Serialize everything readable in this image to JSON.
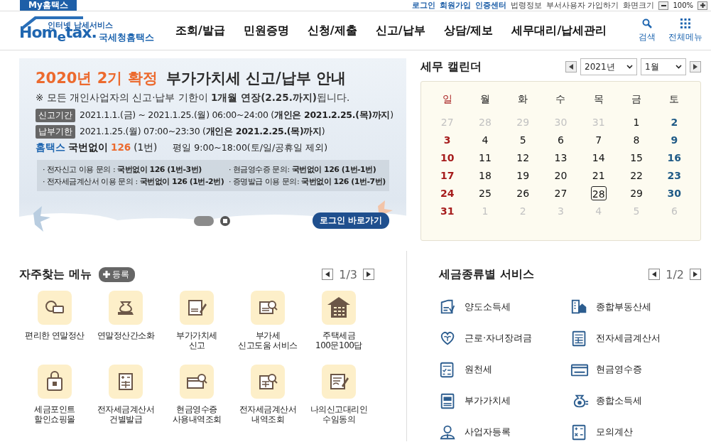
{
  "top_bar": {
    "tab": "My홈택스",
    "links": [
      "로그인",
      "회원가입",
      "인증센터"
    ],
    "sub_links": [
      "법령정보",
      "부서사용자 가입하기"
    ],
    "zoom_label": "화면크기",
    "zoom_value": "100%"
  },
  "header": {
    "logo_small": "인터넷 납세서비스",
    "logo": "Hom$_{e}$tax.",
    "logo_org": "국세청홈택스",
    "nav": [
      "조회/발급",
      "민원증명",
      "신청/제출",
      "신고/납부",
      "상담/제보",
      "세무대리/납세관리"
    ],
    "search": "검색",
    "all_menu": "전체메뉴"
  },
  "banner": {
    "title_highlight": "2020년 2기 확정",
    "title": "부가가치세 신고/납부 안내",
    "notice": "※ 모든 개인사업자의 신고·납부 기한이 **1개월 연장(2.25.까지)**됩니다.",
    "periods": [
      {
        "label": "신고기간",
        "text": "2021.1.1.(금) ~ 2021.1.25.(월) 06:00~24:00 (**개인은 2021.2.25.(목)까지**)"
      },
      {
        "label": "납부기한",
        "text": "2021.1.25.(월) 07:00~23:30 (**개인은 2021.2.25.(목)까지**)"
      }
    ],
    "phone": {
      "brand": "홈택스",
      "prefix": "국번없이",
      "number": "126",
      "suffix": "(1번)",
      "hours": "평일 9:00~18:00(토/일/공휴일 제외)"
    },
    "inquiries": [
      "· 전자신고 이용 문의 : **국번없이 126 (1번-3번)**",
      "· 현금영수증 문의: **국번없이 126 (1번-1번)**",
      "· 전자세금계산서 이용 문의 : **국번없이 126 (1번-2번)**",
      "· 증명발급 이용 문의: **국번없이 126 (1번-7번)**"
    ],
    "login_button": "로그인 바로가기"
  },
  "calendar": {
    "title": "세무 캘린더",
    "year": "2021년",
    "month": "1월",
    "weekdays": [
      "일",
      "월",
      "화",
      "수",
      "목",
      "금",
      "토"
    ],
    "weeks": [
      [
        {
          "day": "27",
          "muted": true,
          "selected": false
        },
        {
          "day": "28",
          "muted": true,
          "selected": false
        },
        {
          "day": "29",
          "muted": true,
          "selected": false
        },
        {
          "day": "30",
          "muted": true,
          "selected": false
        },
        {
          "day": "31",
          "muted": true,
          "selected": false
        },
        {
          "day": "1",
          "muted": false,
          "selected": false
        },
        {
          "day": "2",
          "muted": false,
          "selected": false
        }
      ],
      [
        {
          "day": "3",
          "muted": false,
          "selected": false
        },
        {
          "day": "4",
          "muted": false,
          "selected": false
        },
        {
          "day": "5",
          "muted": false,
          "selected": false
        },
        {
          "day": "6",
          "muted": false,
          "selected": false
        },
        {
          "day": "7",
          "muted": false,
          "selected": false
        },
        {
          "day": "8",
          "muted": false,
          "selected": false
        },
        {
          "day": "9",
          "muted": false,
          "selected": false
        }
      ],
      [
        {
          "day": "10",
          "muted": false,
          "selected": false
        },
        {
          "day": "11",
          "muted": false,
          "selected": false
        },
        {
          "day": "12",
          "muted": false,
          "selected": false
        },
        {
          "day": "13",
          "muted": false,
          "selected": false
        },
        {
          "day": "14",
          "muted": false,
          "selected": false
        },
        {
          "day": "15",
          "muted": false,
          "selected": false
        },
        {
          "day": "16",
          "muted": false,
          "selected": false
        }
      ],
      [
        {
          "day": "17",
          "muted": false,
          "selected": false
        },
        {
          "day": "18",
          "muted": false,
          "selected": false
        },
        {
          "day": "19",
          "muted": false,
          "selected": false
        },
        {
          "day": "20",
          "muted": false,
          "selected": false
        },
        {
          "day": "21",
          "muted": false,
          "selected": false
        },
        {
          "day": "22",
          "muted": false,
          "selected": false
        },
        {
          "day": "23",
          "muted": false,
          "selected": false
        }
      ],
      [
        {
          "day": "24",
          "muted": false,
          "selected": false
        },
        {
          "day": "25",
          "muted": false,
          "selected": false
        },
        {
          "day": "26",
          "muted": false,
          "selected": false
        },
        {
          "day": "27",
          "muted": false,
          "selected": false
        },
        {
          "day": "28",
          "muted": false,
          "selected": true
        },
        {
          "day": "29",
          "muted": false,
          "selected": false
        },
        {
          "day": "30",
          "muted": false,
          "selected": false
        }
      ],
      [
        {
          "day": "31",
          "muted": false,
          "selected": false
        },
        {
          "day": "1",
          "muted": true,
          "selected": false
        },
        {
          "day": "2",
          "muted": true,
          "selected": false
        },
        {
          "day": "3",
          "muted": true,
          "selected": false
        },
        {
          "day": "4",
          "muted": true,
          "selected": false
        },
        {
          "day": "5",
          "muted": true,
          "selected": false
        },
        {
          "day": "6",
          "muted": true,
          "selected": false
        }
      ]
    ]
  },
  "favorites": {
    "title": "자주찾는 메뉴",
    "add_button": "등록",
    "page": "1/3",
    "items": [
      "편리한 연말정산",
      "연말정산간소화",
      "부가가치세\n신고",
      "부가세\n신고도움 서비스",
      "주택세금\n100문100답",
      "세금포인트\n할인쇼핑몰",
      "전자세금계산서\n건별발급",
      "현금영수증\n사용내역조회",
      "전자세금계산서\n내역조회",
      "나의신고대리인\n수임동의"
    ]
  },
  "tax_services": {
    "title": "세금종류별 서비스",
    "page": "1/2",
    "items": [
      "양도소득세",
      "종합부동산세",
      "근로·자녀장려금",
      "전자세금계산서",
      "원천세",
      "현금영수증",
      "부가가치세",
      "종합소득세",
      "사업자등록",
      "모의계산"
    ]
  }
}
